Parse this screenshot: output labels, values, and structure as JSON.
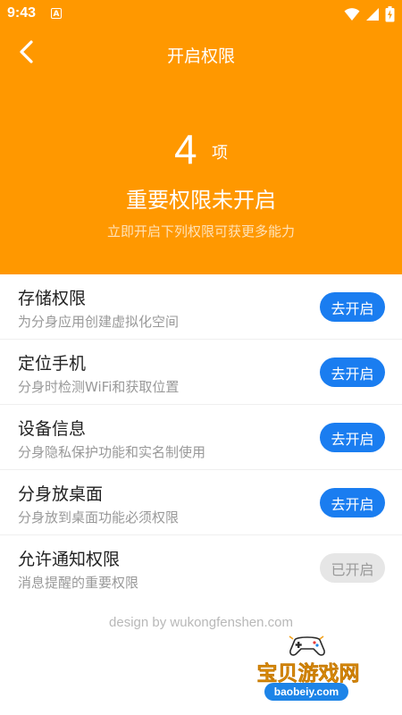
{
  "status_bar": {
    "time": "9:43",
    "notification_badge": "A"
  },
  "nav": {
    "title": "开启权限"
  },
  "summary": {
    "count": "4",
    "unit": "项",
    "title": "重要权限未开启",
    "subtitle": "立即开启下列权限可获更多能力"
  },
  "permissions": [
    {
      "title": "存储权限",
      "desc": "为分身应用创建虚拟化空间",
      "button": "去开启",
      "enabled": false
    },
    {
      "title": "定位手机",
      "desc": "分身时检测WiFi和获取位置",
      "button": "去开启",
      "enabled": false
    },
    {
      "title": "设备信息",
      "desc": "分身隐私保护功能和实名制使用",
      "button": "去开启",
      "enabled": false
    },
    {
      "title": "分身放桌面",
      "desc": "分身放到桌面功能必须权限",
      "button": "去开启",
      "enabled": false
    },
    {
      "title": "允许通知权限",
      "desc": "消息提醒的重要权限",
      "button": "已开启",
      "enabled": true
    }
  ],
  "footer": {
    "credit": "design by wukongfenshen.com"
  },
  "watermark": {
    "name": "宝贝游戏网",
    "url": "baobeiy.com"
  },
  "colors": {
    "header_bg": "#ff9800",
    "button_blue": "#1a7df0",
    "button_disabled": "#e6e6e6"
  },
  "icons": {
    "back": "chevron-left-icon",
    "wifi": "wifi-icon",
    "signal": "cell-signal-icon",
    "battery": "battery-icon"
  }
}
